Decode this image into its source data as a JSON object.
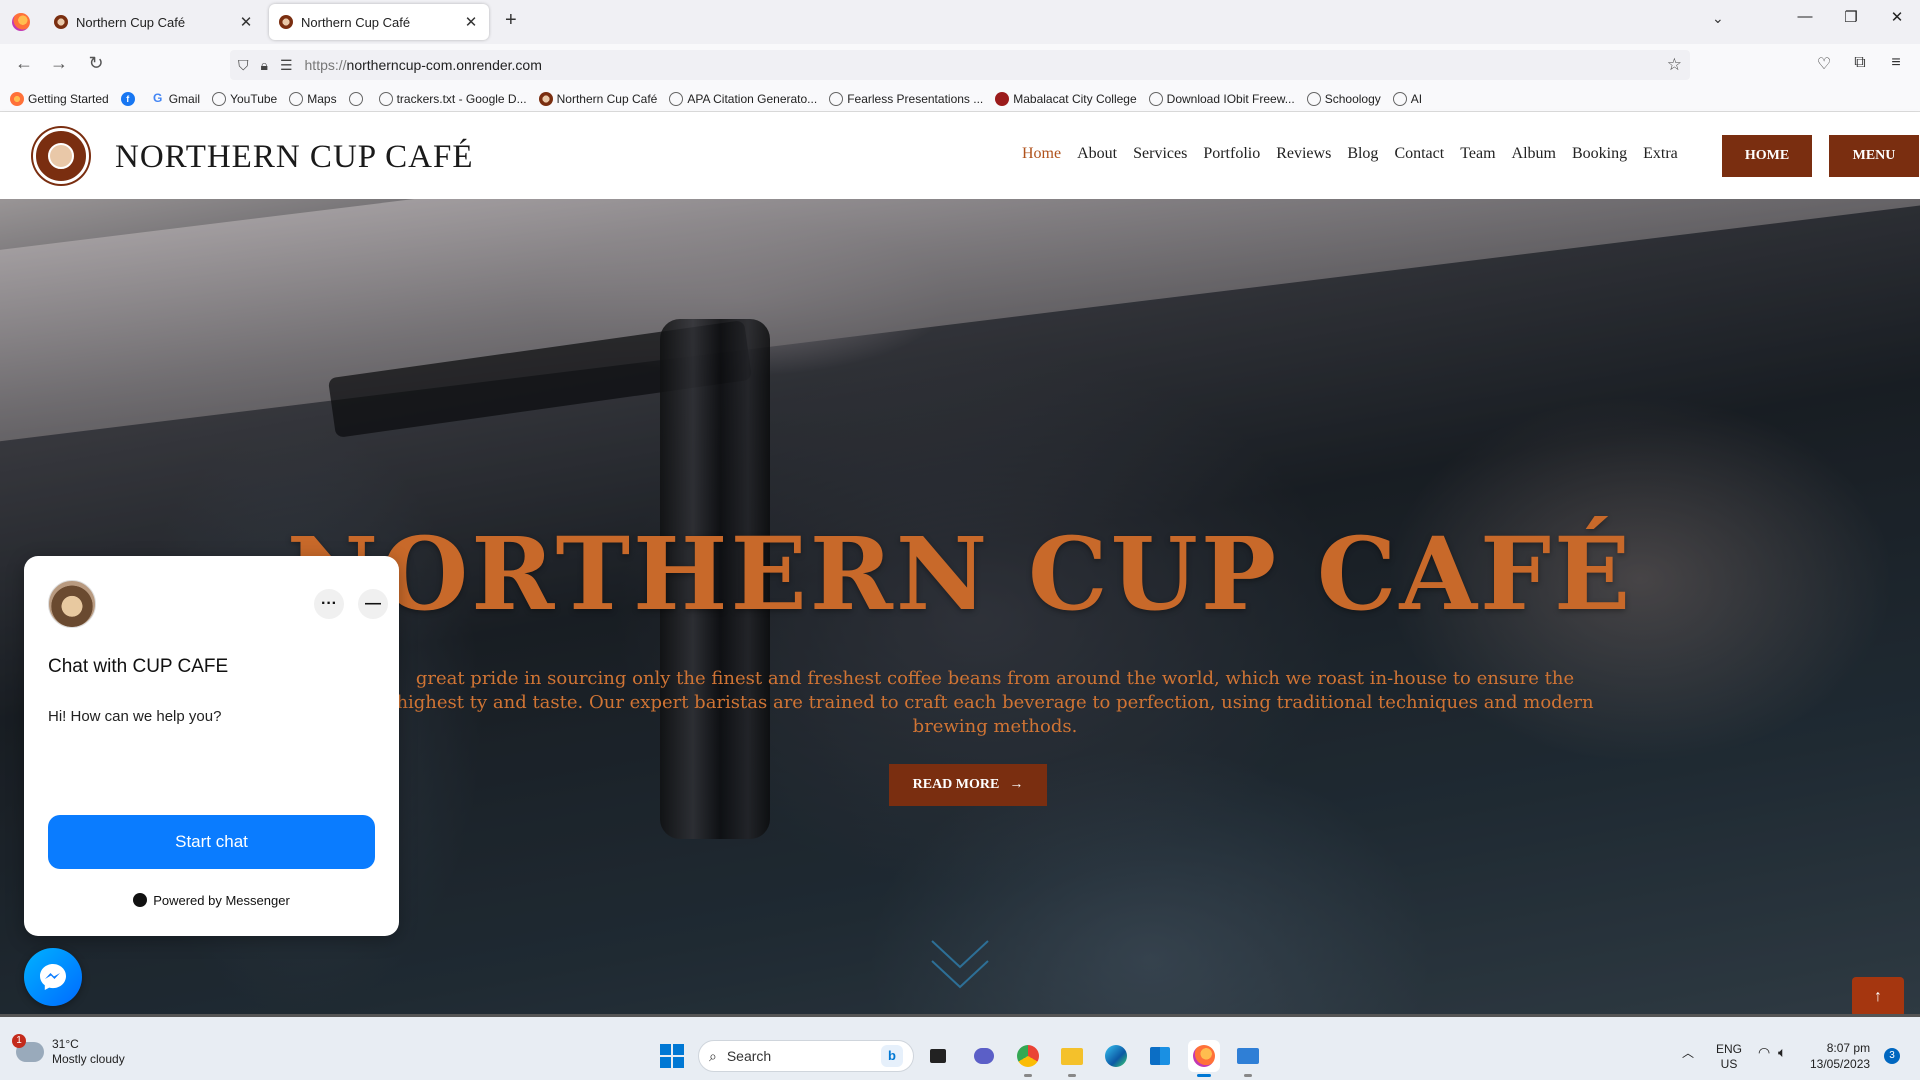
{
  "browser": {
    "tabs": [
      {
        "title": "Northern Cup Café",
        "active": false
      },
      {
        "title": "Northern Cup Café",
        "active": true
      }
    ],
    "url_prefix": "https://",
    "url_host": "northerncup-com.onrender.com",
    "bookmarks": [
      {
        "label": "Getting Started",
        "icon": "firefox-icon"
      },
      {
        "label": "",
        "icon": "facebook-icon"
      },
      {
        "label": "Gmail",
        "icon": "google-icon"
      },
      {
        "label": "YouTube",
        "icon": "globe-icon"
      },
      {
        "label": "Maps",
        "icon": "globe-icon"
      },
      {
        "label": "",
        "icon": "globe-icon"
      },
      {
        "label": "trackers.txt - Google D...",
        "icon": "globe-icon"
      },
      {
        "label": "Northern Cup Café",
        "icon": "site-icon"
      },
      {
        "label": "APA Citation Generato...",
        "icon": "globe-icon"
      },
      {
        "label": "Fearless Presentations ...",
        "icon": "globe-icon"
      },
      {
        "label": "Mabalacat City College",
        "icon": "college-icon"
      },
      {
        "label": "Download IObit Freew...",
        "icon": "globe-icon"
      },
      {
        "label": "Schoology",
        "icon": "globe-icon"
      },
      {
        "label": "AI",
        "icon": "globe-icon"
      }
    ]
  },
  "site": {
    "brand": "NORTHERN CUP CAFÉ",
    "nav": [
      "Home",
      "About",
      "Services",
      "Portfolio",
      "Reviews",
      "Blog",
      "Contact",
      "Team",
      "Album",
      "Booking",
      "Extra"
    ],
    "current_nav": "Home",
    "home_button": "HOME",
    "menu_button": "MENU",
    "colors": {
      "accent": "#7a2e10",
      "title_orange": "#c8692a",
      "nav_active": "#b0521c"
    }
  },
  "hero": {
    "title": "NORTHERN CUP CAFÉ",
    "text": "great pride in sourcing only the finest and freshest coffee beans from around the world, which we roast in-house to ensure the highest ty and taste. Our expert baristas are trained to craft each beverage to perfection, using traditional techniques and modern brewing methods.",
    "read_more": "READ MORE"
  },
  "chat_widget": {
    "title": "Chat with CUP CAFE",
    "greeting": "Hi! How can we help you?",
    "start_button": "Start chat",
    "powered_by": "Powered by Messenger",
    "accent": "#0a7cff"
  },
  "taskbar": {
    "weather_temp": "31°C",
    "weather_desc": "Mostly cloudy",
    "weather_badge": "1",
    "search_placeholder": "Search",
    "lang_line1": "ENG",
    "lang_line2": "US",
    "time": "8:07 pm",
    "date": "13/05/2023",
    "notification_count": "3"
  }
}
